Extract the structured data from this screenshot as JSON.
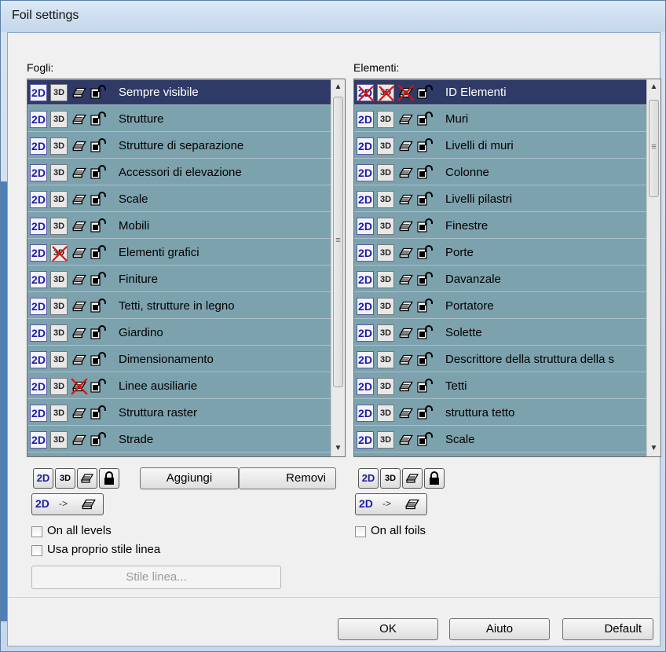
{
  "window": {
    "title": "Foil settings"
  },
  "left": {
    "label": "Fogli:",
    "rows": [
      {
        "label": "Sempre visibile",
        "selected": true,
        "d3x": false,
        "prx": false
      },
      {
        "label": "Strutture",
        "selected": false,
        "d3x": false,
        "prx": false
      },
      {
        "label": "Strutture di separazione",
        "selected": false,
        "d3x": false,
        "prx": false
      },
      {
        "label": "Accessori di elevazione",
        "selected": false,
        "d3x": false,
        "prx": false
      },
      {
        "label": "Scale",
        "selected": false,
        "d3x": false,
        "prx": false
      },
      {
        "label": "Mobili",
        "selected": false,
        "d3x": false,
        "prx": false
      },
      {
        "label": "Elementi grafici",
        "selected": false,
        "d3x": true,
        "prx": false
      },
      {
        "label": "Finiture",
        "selected": false,
        "d3x": false,
        "prx": false
      },
      {
        "label": "Tetti, strutture in legno",
        "selected": false,
        "d3x": false,
        "prx": false
      },
      {
        "label": "Giardino",
        "selected": false,
        "d3x": false,
        "prx": false
      },
      {
        "label": "Dimensionamento",
        "selected": false,
        "d3x": false,
        "prx": false
      },
      {
        "label": "Linee ausiliarie",
        "selected": false,
        "d3x": false,
        "prx": true
      },
      {
        "label": "Struttura raster",
        "selected": false,
        "d3x": false,
        "prx": false
      },
      {
        "label": "Strade",
        "selected": false,
        "d3x": false,
        "prx": false
      }
    ],
    "add_label": "Aggiungi",
    "remove_label": "Removi",
    "on_all_levels_label": "On all levels",
    "own_line_style_label": "Usa proprio stile linea",
    "line_style_button": "Stile linea..."
  },
  "right": {
    "label": "Elementi:",
    "rows": [
      {
        "label": "ID Elementi",
        "selected": true,
        "d2x": true,
        "d3x": true,
        "prx": true
      },
      {
        "label": "Muri",
        "selected": false
      },
      {
        "label": "Livelli di muri",
        "selected": false
      },
      {
        "label": "Colonne",
        "selected": false
      },
      {
        "label": "Livelli pilastri",
        "selected": false
      },
      {
        "label": "Finestre",
        "selected": false
      },
      {
        "label": "Porte",
        "selected": false
      },
      {
        "label": "Davanzale",
        "selected": false
      },
      {
        "label": "Portatore",
        "selected": false
      },
      {
        "label": "Solette",
        "selected": false
      },
      {
        "label": "Descrittore della struttura della s",
        "selected": false
      },
      {
        "label": "Tetti",
        "selected": false
      },
      {
        "label": "struttura tetto",
        "selected": false
      },
      {
        "label": "Scale",
        "selected": false
      }
    ],
    "on_all_foils_label": "On all foils"
  },
  "toolbar": {
    "btn_2d": "2D",
    "btn_3d": "3D",
    "convert_label": "2D",
    "convert_arrow": "->"
  },
  "footer": {
    "ok": "OK",
    "help": "Aiuto",
    "default": "Default"
  }
}
